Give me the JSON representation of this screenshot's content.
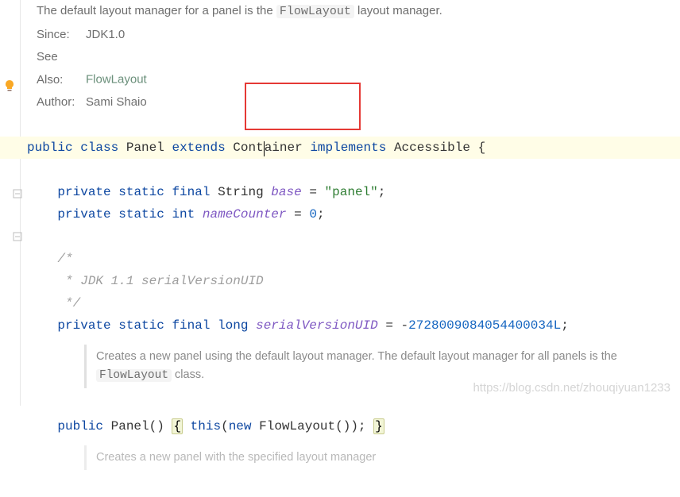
{
  "doc": {
    "summary_prefix": "The default layout manager for a panel is the ",
    "summary_code": "FlowLayout",
    "summary_suffix": " layout manager.",
    "since_label": "Since:",
    "since_value": "JDK1.0",
    "seealso_label": "See Also:",
    "seealso_link": "FlowLayout",
    "author_label": "Author:",
    "author_value": "Sami Shaio"
  },
  "code": {
    "l1_public": "public",
    "l1_class": "class",
    "l1_name": "Panel",
    "l1_extends": "extends",
    "l1_super_a": "Cont",
    "l1_super_b": "ainer",
    "l1_implements": "implements",
    "l1_iface": "Accessible",
    "l1_brace": "{",
    "l2_private": "private",
    "l2_static": "static",
    "l2_final": "final",
    "l2_type": "String",
    "l2_name": "base",
    "l2_eq": "=",
    "l2_value": "\"panel\"",
    "l2_semi": ";",
    "l3_private": "private",
    "l3_static": "static",
    "l3_type": "int",
    "l3_name": "nameCounter",
    "l3_eq": "=",
    "l3_value": "0",
    "l3_semi": ";",
    "c_open": "/*",
    "c_line": " * JDK 1.1 serialVersionUID",
    "c_close": " */",
    "l4_private": "private",
    "l4_static": "static",
    "l4_final": "final",
    "l4_type": "long",
    "l4_name": "serialVersionUID",
    "l4_eq": "=",
    "l4_neg": "-",
    "l4_value": "2728009084054400034L",
    "l4_semi": ";",
    "doc1_a": "Creates a new panel using the default layout manager. The default layout manager for all panels is the ",
    "doc1_code": "FlowLayout",
    "doc1_b": " class.",
    "l5_public": "public",
    "l5_name": "Panel",
    "l5_paren": "()",
    "l5_open": "{",
    "l5_this": "this",
    "l5_p_open": "(",
    "l5_new": "new",
    "l5_ctor": "FlowLayout",
    "l5_p_close": "());",
    "l5_close": "}",
    "doc2": "Creates a new panel with the specified layout manager"
  },
  "watermark": "https://blog.csdn.net/zhouqiyuan1233"
}
